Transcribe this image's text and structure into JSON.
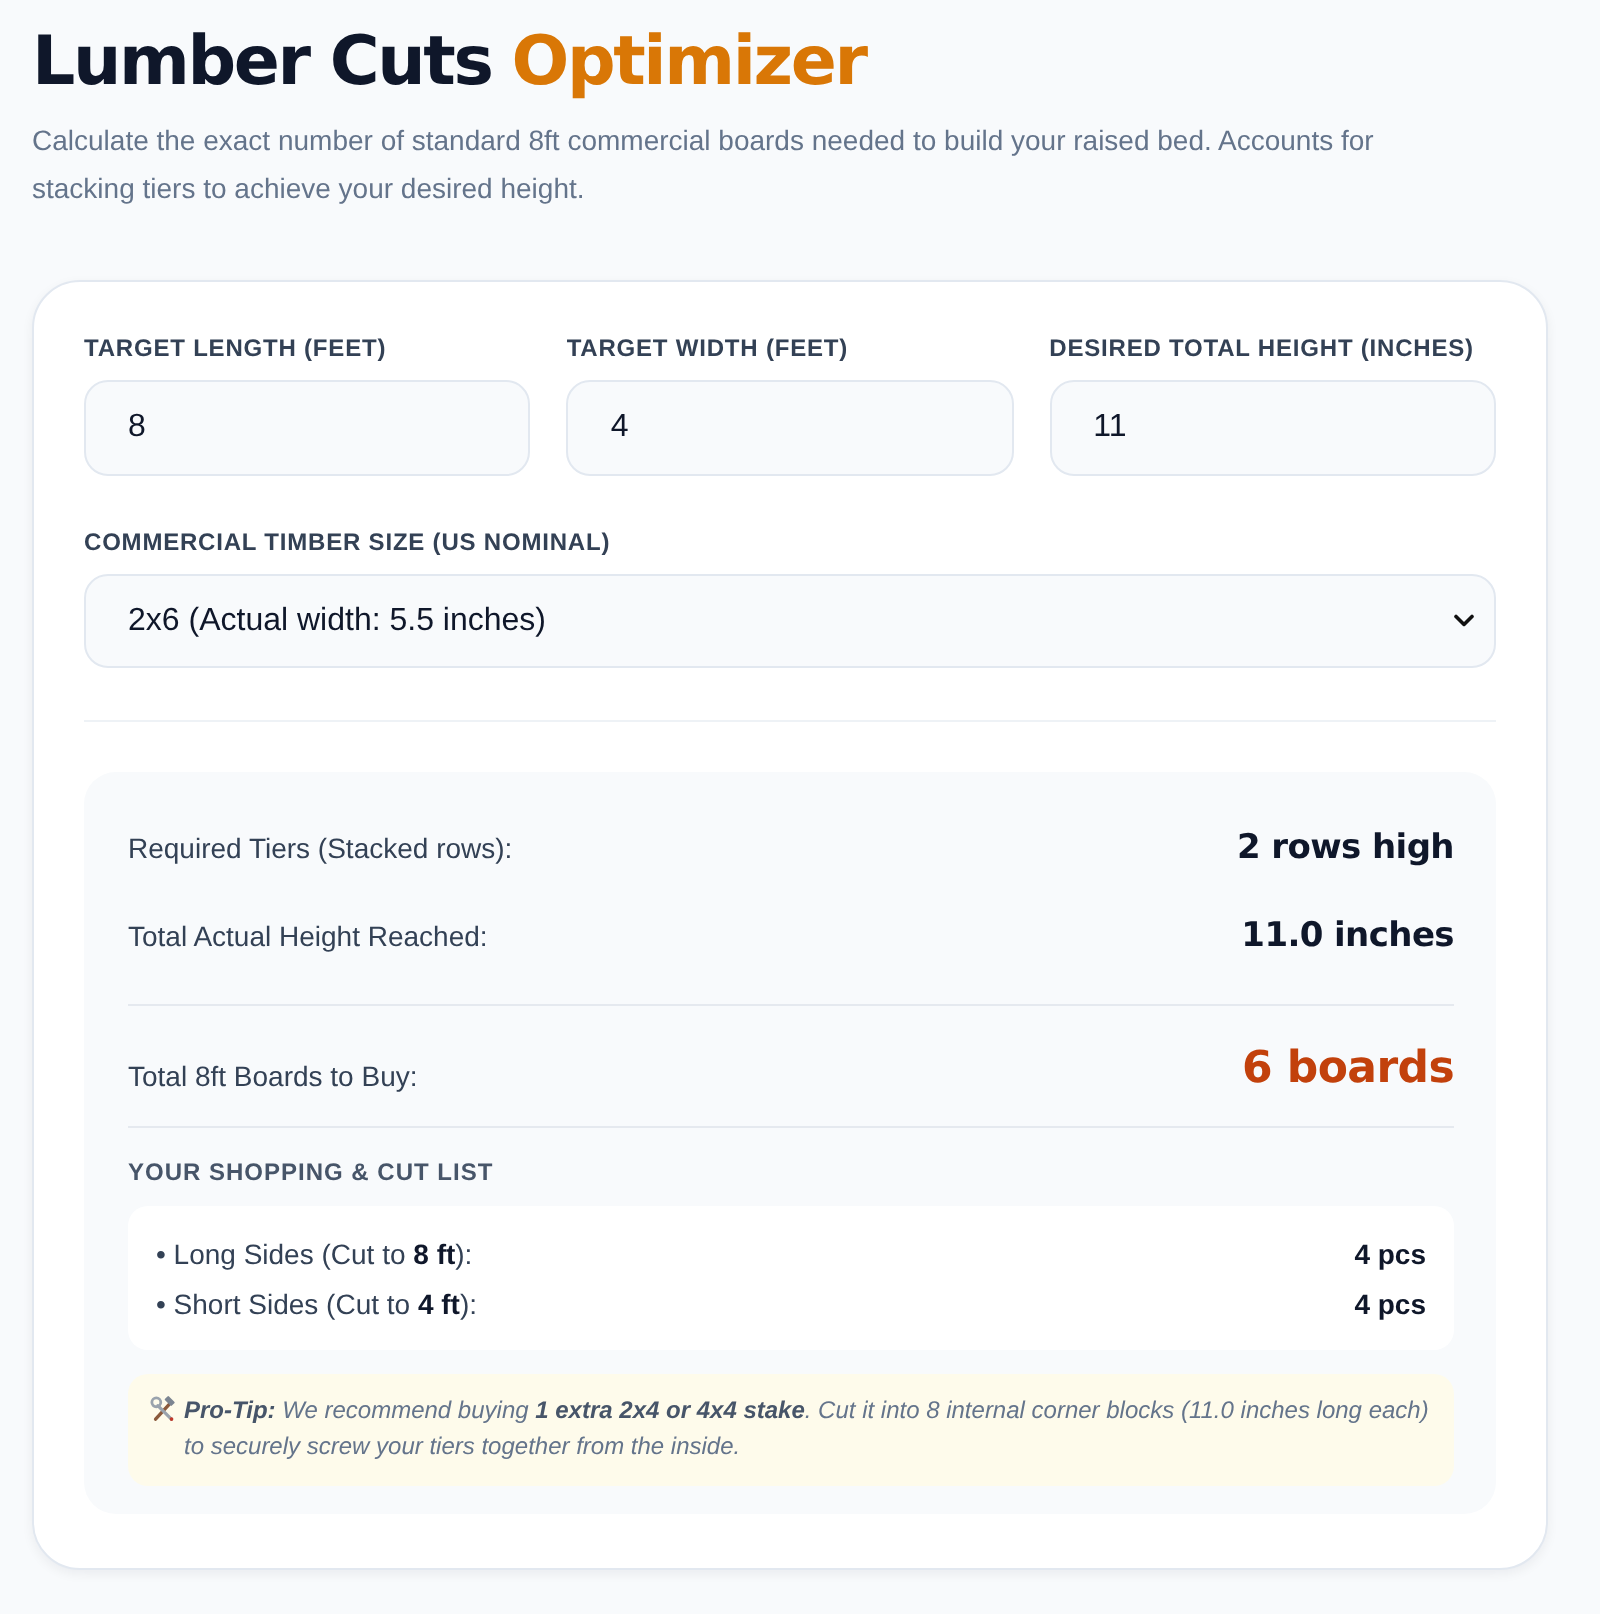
{
  "header": {
    "title": "Lumber Cuts",
    "title_accent": "Optimizer",
    "subtitle": "Calculate the exact number of standard 8ft commercial boards needed to build your raised bed. Accounts for stacking tiers to achieve your desired height."
  },
  "fields": [
    {
      "label": "TARGET LENGTH (FEET)",
      "value": "8"
    },
    {
      "label": "TARGET WIDTH (FEET)",
      "value": "4"
    },
    {
      "label": "DESIRED TOTAL HEIGHT (INCHES)",
      "value": "11"
    }
  ],
  "timber": {
    "label": "COMMERCIAL TIMBER SIZE (US NOMINAL)",
    "value": "2x6 (Actual width: 5.5 inches)"
  },
  "results": {
    "rows": [
      {
        "kind": "stat",
        "label": "Required Tiers (Stacked rows):",
        "value": "2 rows high"
      },
      {
        "kind": "stat",
        "label": "Total Actual Height Reached:",
        "value": "11.0 inches"
      },
      {
        "kind": "total",
        "label": "Total 8ft Boards to Buy:",
        "value": "6 boards"
      }
    ],
    "cut_list": {
      "heading": "YOUR SHOPPING & CUT LIST",
      "items": [
        {
          "label": "• Long Sides (Cut to **8 ft**):",
          "quantity": "4 pcs"
        },
        {
          "label": "• Short Sides (Cut to **4 ft**):",
          "quantity": "4 pcs"
        }
      ]
    },
    "pro_tip": "**Pro-Tip:** We recommend buying **1 extra 2x4 or 4x4 stake**. Cut it into 8 internal corner blocks (11.0 inches long each) to securely screw your tiers together from the inside."
  }
}
